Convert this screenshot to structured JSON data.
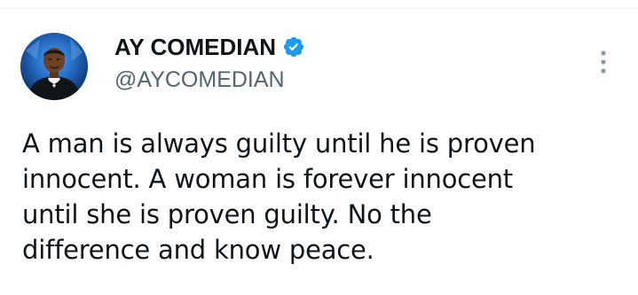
{
  "tweet": {
    "author": {
      "display_name": "AY COMEDIAN",
      "handle": "@AYCOMEDIAN",
      "verified": true
    },
    "text": "A man is always guilty until he is proven\ninnocent. A woman is forever innocent\nuntil she is proven guilty. No the\ndifference and know peace.",
    "more_icon": "more-vertical-icon",
    "verified_icon": "verified-badge-icon"
  },
  "colors": {
    "primary_text": "#0f1419",
    "secondary_text": "#536471",
    "verified_blue": "#1d9bf0",
    "divider": "#eff3f4",
    "avatar_bg": "#1f5fb4"
  }
}
